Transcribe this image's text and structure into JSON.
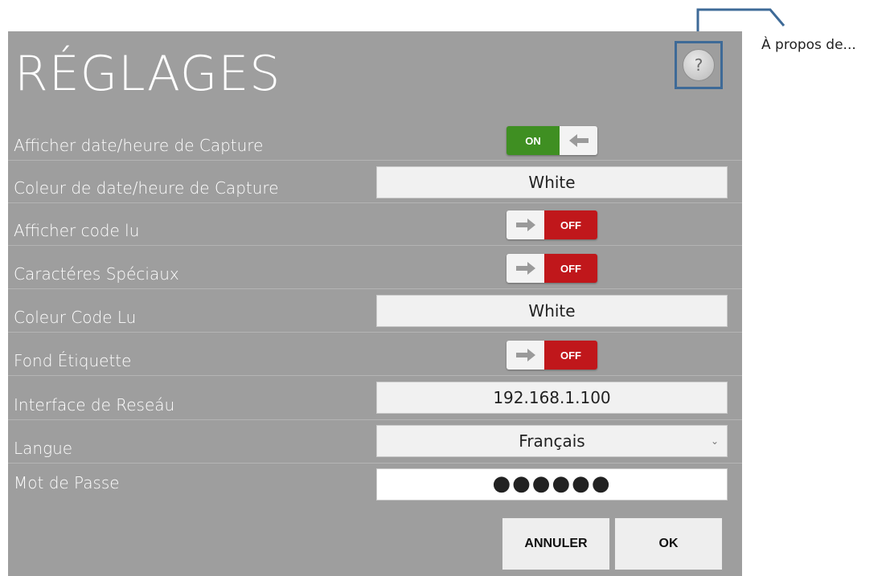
{
  "callout": {
    "text": "À propos de..."
  },
  "window": {
    "title": "RÉGLAGES"
  },
  "help": {
    "glyph": "?"
  },
  "settings": {
    "show_capture_datetime": {
      "label": "Afficher date/heure de Capture",
      "state": "ON"
    },
    "capture_datetime_color": {
      "label": "Coleur de date/heure de Capture",
      "value": "White"
    },
    "show_read_code": {
      "label": "Afficher code lu",
      "state": "OFF"
    },
    "special_chars": {
      "label": "Caractéres Spéciaux",
      "state": "OFF"
    },
    "read_code_color": {
      "label": "Coleur Code Lu",
      "value": "White"
    },
    "label_background": {
      "label": "Fond Étiquette",
      "state": "OFF"
    },
    "network_interface": {
      "label": "Interface de Reseáu",
      "value": "192.168.1.100"
    },
    "language": {
      "label": "Langue",
      "value": "Français",
      "chevron": "⌄"
    },
    "password": {
      "label": "Mot de Passe",
      "value": "●●●●●●"
    }
  },
  "buttons": {
    "cancel": "ANNULER",
    "ok": "OK"
  },
  "colors": {
    "panel_bg": "#9e9e9e",
    "toggle_on": "#3f8f22",
    "toggle_off": "#c0171b",
    "help_outline": "#3e6a97"
  },
  "icons": {
    "toggle_on_arrow": "arrow-left-icon",
    "toggle_off_arrow": "arrow-right-icon",
    "help": "question-icon",
    "language_chevron": "chevron-down-icon"
  }
}
